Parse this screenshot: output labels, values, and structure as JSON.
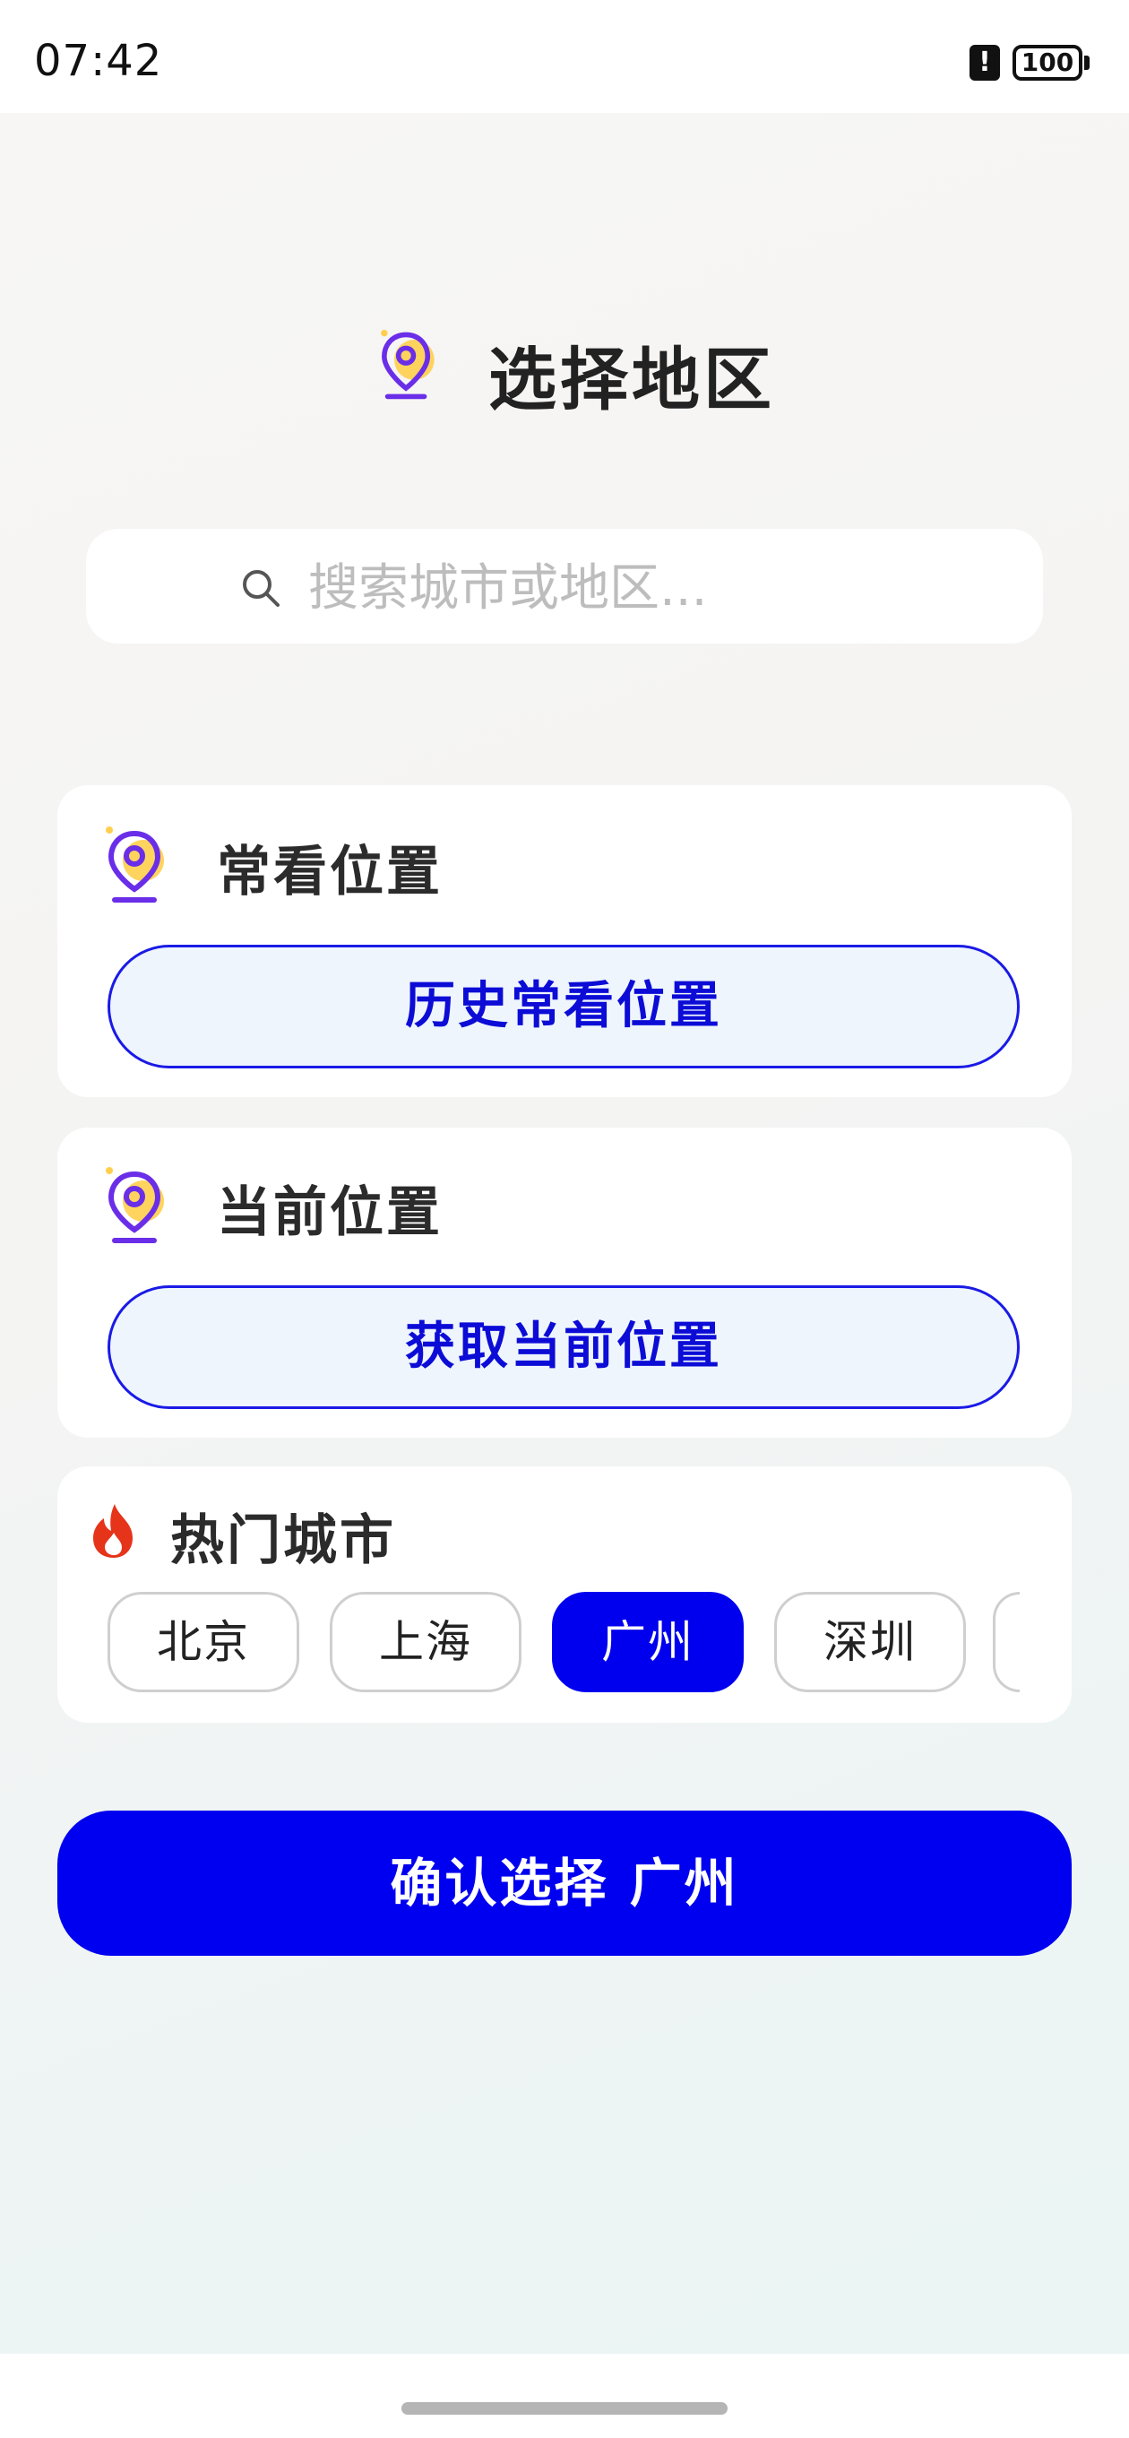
{
  "status_bar": {
    "time": "07:42",
    "alert_glyph": "!",
    "battery": "100",
    "icons": [
      "alert-icon",
      "battery-icon"
    ]
  },
  "header": {
    "title": "选择地区",
    "icon": "location-pin-icon"
  },
  "search": {
    "placeholder": "搜索城市或地区...",
    "value": "",
    "icon": "search-icon"
  },
  "frequent": {
    "title": "常看位置",
    "button_label": "历史常看位置",
    "icon": "location-pin-icon"
  },
  "current": {
    "title": "当前位置",
    "button_label": "获取当前位置",
    "icon": "location-pin-icon"
  },
  "hot": {
    "title": "热门城市",
    "icon": "fire-icon",
    "cities": [
      "北京",
      "上海",
      "广州",
      "深圳"
    ],
    "selected": "广州"
  },
  "confirm": {
    "label": "确认选择 广州"
  },
  "colors": {
    "accent": "#0000f0",
    "button_bg": "#eef5fd",
    "pin_purple": "#6a2ee8",
    "pin_yellow": "#ffcf4d",
    "fire_red": "#e5341a"
  }
}
